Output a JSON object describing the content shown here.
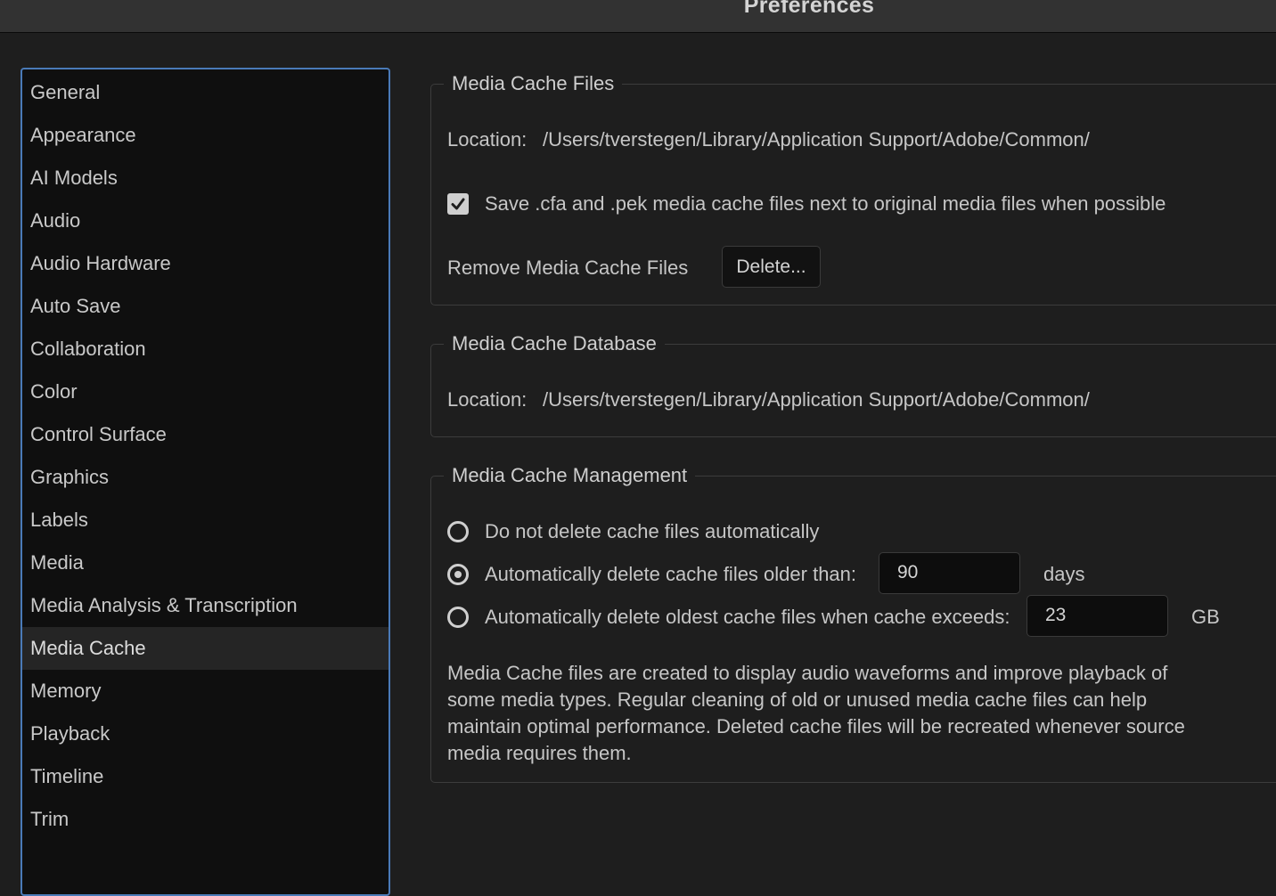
{
  "window": {
    "title": "Preferences"
  },
  "sidebar": {
    "items": [
      {
        "label": "General"
      },
      {
        "label": "Appearance"
      },
      {
        "label": "AI Models"
      },
      {
        "label": "Audio"
      },
      {
        "label": "Audio Hardware"
      },
      {
        "label": "Auto Save"
      },
      {
        "label": "Collaboration"
      },
      {
        "label": "Color"
      },
      {
        "label": "Control Surface"
      },
      {
        "label": "Graphics"
      },
      {
        "label": "Labels"
      },
      {
        "label": "Media"
      },
      {
        "label": "Media Analysis & Transcription"
      },
      {
        "label": "Media Cache",
        "selected": true
      },
      {
        "label": "Memory"
      },
      {
        "label": "Playback"
      },
      {
        "label": "Timeline"
      },
      {
        "label": "Trim"
      }
    ]
  },
  "media_cache_files": {
    "legend": "Media Cache Files",
    "location_label": "Location:",
    "location_path": "/Users/tverstegen/Library/Application Support/Adobe/Common/",
    "save_next_to_media_label": "Save .cfa and .pek media cache files next to original media files when possible",
    "save_next_to_media_checked": true,
    "remove_label": "Remove Media Cache Files",
    "delete_button": "Delete..."
  },
  "media_cache_database": {
    "legend": "Media Cache Database",
    "location_label": "Location:",
    "location_path": "/Users/tverstegen/Library/Application Support/Adobe/Common/"
  },
  "media_cache_management": {
    "legend": "Media Cache Management",
    "option_no_delete": "Do not delete cache files automatically",
    "option_older_than": "Automatically delete cache files older than:",
    "older_than_value": "90",
    "older_than_unit": "days",
    "option_exceeds": "Automatically delete oldest cache files when cache exceeds:",
    "exceeds_value": "23",
    "exceeds_unit": "GB",
    "selected_option": "older_than",
    "description": "Media Cache files are created to display audio waveforms and improve playback of some media types.  Regular cleaning of old or unused media cache files can help maintain optimal performance. Deleted cache files will be recreated whenever source media requires them."
  }
}
